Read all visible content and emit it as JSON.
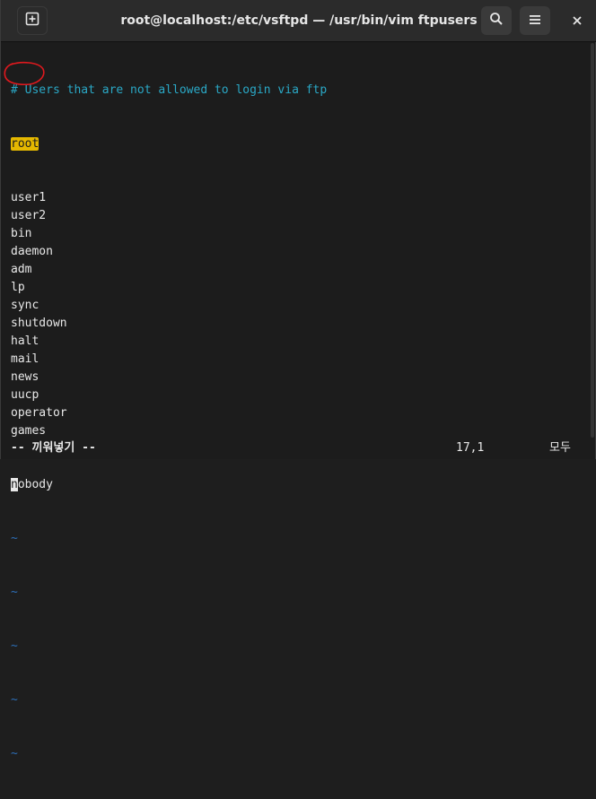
{
  "window": {
    "title": "root@localhost:/etc/vsftpd — /usr/bin/vim ftpusers",
    "icons": {
      "new_tab": "new-tab-icon",
      "search": "search-icon",
      "menu": "hamburger-menu-icon",
      "close": "close-icon"
    }
  },
  "editor": {
    "comment": "# Users that are not allowed to login via ftp",
    "highlighted_first": "root",
    "users": [
      "user1",
      "user2",
      "bin",
      "daemon",
      "adm",
      "lp",
      "sync",
      "shutdown",
      "halt",
      "mail",
      "news",
      "uucp",
      "operator",
      "games"
    ],
    "cursor_line_first_char": "n",
    "cursor_line_rest": "obody",
    "tilde": "~"
  },
  "status": {
    "mode": "-- 끼워넣기 --",
    "position": "17,1",
    "scroll": "모두"
  },
  "colors": {
    "background": "#1c1c1c",
    "comment": "#2aa8c6",
    "search_highlight": "#e5b800",
    "tilde": "#2d6fb8",
    "annotation": "#e0191e"
  }
}
